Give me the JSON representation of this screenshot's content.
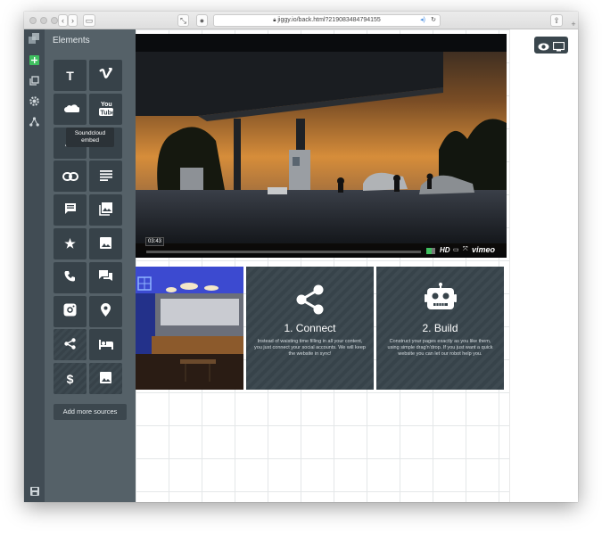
{
  "browser": {
    "url": "jiggy.io/back.html?219083484794155"
  },
  "panel": {
    "title": "Elements",
    "tooltip": "Soundcloud embed",
    "add_more_label": "Add more sources",
    "tiles": [
      {
        "icon": "text-icon",
        "glyph": "T"
      },
      {
        "icon": "vimeo-icon",
        "glyph": "v"
      },
      {
        "icon": "soundcloud-icon",
        "glyph": ""
      },
      {
        "icon": "youtube-icon",
        "glyph": "You Tube"
      },
      {
        "icon": "text-2-icon",
        "glyph": ""
      },
      {
        "icon": "text-3-icon",
        "glyph": "T"
      },
      {
        "icon": "link-icon",
        "glyph": ""
      },
      {
        "icon": "paragraph-icon",
        "glyph": ""
      },
      {
        "icon": "comment-icon",
        "glyph": ""
      },
      {
        "icon": "gallery-icon",
        "glyph": ""
      },
      {
        "icon": "star-icon",
        "glyph": "★"
      },
      {
        "icon": "image-icon",
        "glyph": ""
      },
      {
        "icon": "phone-icon",
        "glyph": ""
      },
      {
        "icon": "chat-icon",
        "glyph": ""
      },
      {
        "icon": "instagram-icon",
        "glyph": ""
      },
      {
        "icon": "location-icon",
        "glyph": ""
      },
      {
        "icon": "share-icon",
        "glyph": ""
      },
      {
        "icon": "bed-icon",
        "glyph": ""
      },
      {
        "icon": "dollar-icon",
        "glyph": "$"
      },
      {
        "icon": "image-2-icon",
        "glyph": ""
      }
    ]
  },
  "video": {
    "time": "03:43",
    "hd_label": "HD",
    "brand": "vimeo"
  },
  "cards": [
    {
      "title": "1. Connect",
      "body": "Instead of waisting time filling in all your content, you just connect your social accounts. We will keep the website in sync!"
    },
    {
      "title": "2. Build",
      "body": "Construct your pages exactly as you like them, using simple drag'n'drop. If you just want a quick website you can let our robot help you."
    }
  ],
  "colors": {
    "rail": "#414c54",
    "panel": "#556168",
    "tile": "#374249",
    "accent": "#3fbf5f"
  }
}
